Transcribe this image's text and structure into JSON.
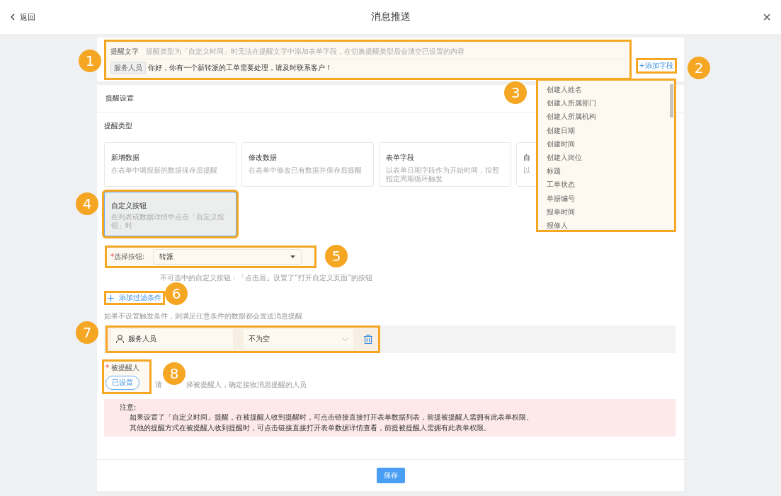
{
  "top_bar": {
    "back": "返回",
    "title": "消息推送",
    "close": "×"
  },
  "reminder_text": {
    "label": "提醒文字",
    "hint": "提醒类型为「自定义时间」时无法在提醒文字中添加表单字段，在切换提醒类型后会清空已设置的内容",
    "tag": "服务人员",
    "message": "你好，你有一个新转派的工单需要处理，请及时联系客户！",
    "add_field": "+添加字段"
  },
  "field_menu": {
    "items": [
      "创建人姓名",
      "创建人所属部门",
      "创建人所属机构",
      "创建日期",
      "创建时间",
      "创建人岗位",
      "标题",
      "工单状态",
      "单据编号",
      "报单时间",
      "报修人"
    ]
  },
  "settings": {
    "title": "提醒设置",
    "type_label": "提醒类型",
    "types": [
      {
        "title": "新增数据",
        "description": "在表单中填报新的数据保存后提醒",
        "selected": false
      },
      {
        "title": "修改数据",
        "description": "在表单中修改已有数据并保存后提醒",
        "selected": false
      },
      {
        "title": "表单字段",
        "description": "以表单日期字段作为开始时间，按照指定周期循环触发",
        "selected": false
      },
      {
        "title": "自",
        "description": "以",
        "selected": false
      },
      {
        "title": "自定义按钮",
        "description": "在列表或数据详情中点击「自定义按钮」时",
        "selected": true
      }
    ],
    "button_select": {
      "required": "*",
      "label": "选择按钮:",
      "value": "转派",
      "hint": "不可选中的自定义按钮：「点击后」设置了“打开自定义页面”的按钮"
    },
    "add_filter": "添加过滤条件",
    "filter_hint": "如果不设置触发条件，则满足任意条件的数据都会发送消息提醒",
    "filters": [
      {
        "field": "服务人员",
        "condition": "不为空"
      }
    ],
    "recipients": {
      "required": "*",
      "label": "被提醒人",
      "button": "已设置",
      "hint_start": "请",
      "hint_end": "择被提醒人，确定接收消息提醒的人员"
    },
    "notice": {
      "title": "注意:",
      "lines": [
        "如果设置了「自定义时间」提醒，在被提醒人收到提醒时，可点击链接直接打开表单数据列表，前提被提醒人需拥有此表单权限。",
        "其他的提醒方式在被提醒人收到提醒时，可点击链接直接打开表单数据详情查看，前提被提醒人需拥有此表单权限。"
      ]
    }
  },
  "save": "保存",
  "annotations": [
    "1",
    "2",
    "3",
    "4",
    "5",
    "6",
    "7",
    "8"
  ]
}
